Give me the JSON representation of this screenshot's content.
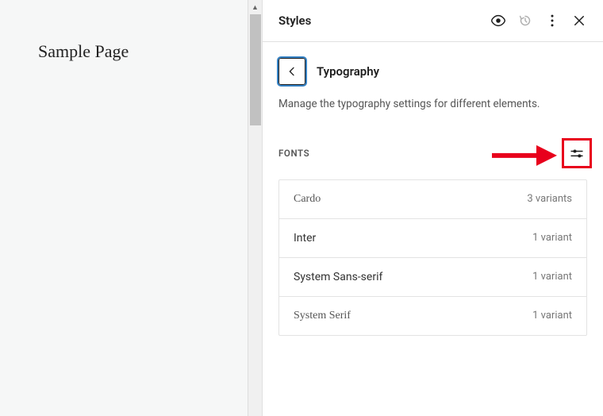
{
  "preview": {
    "title": "Sample Page"
  },
  "header": {
    "title": "Styles"
  },
  "section": {
    "title": "Typography",
    "description": "Manage the typography settings for different elements."
  },
  "fonts": {
    "label": "FONTS",
    "items": [
      {
        "name": "Cardo",
        "variants": "3 variants",
        "serif": true
      },
      {
        "name": "Inter",
        "variants": "1 variant",
        "serif": false
      },
      {
        "name": "System Sans-serif",
        "variants": "1 variant",
        "serif": false
      },
      {
        "name": "System Serif",
        "variants": "1 variant",
        "serif": true
      }
    ]
  },
  "annotation": {
    "color": "#e8001c"
  }
}
